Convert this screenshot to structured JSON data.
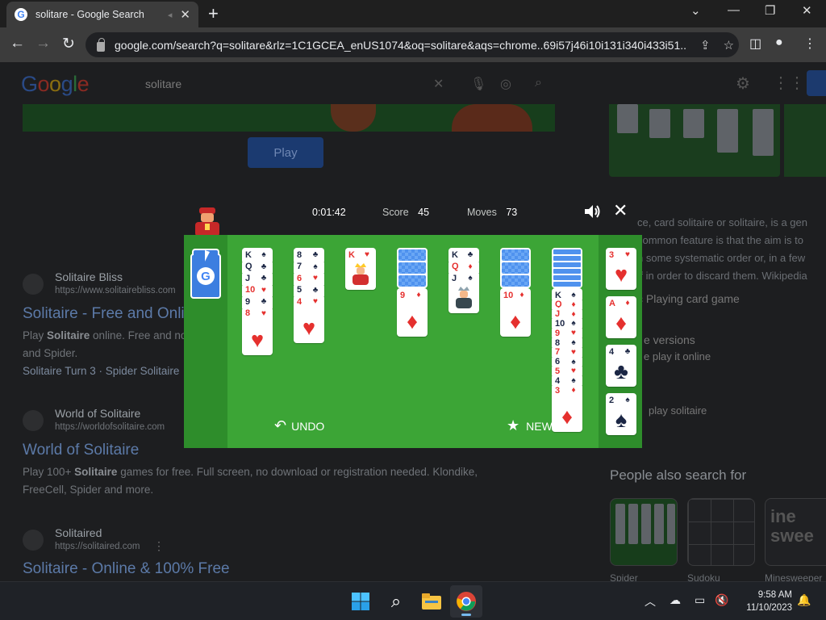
{
  "browser": {
    "tab_title": "solitare - Google Search",
    "favicon_letter": "G",
    "url": "google.com/search?q=solitare&rlz=1C1GCEA_enUS1074&oq=solitare&aqs=chrome..69i57j46i10i131i340i433i51..."
  },
  "google": {
    "logo_letters": [
      "G",
      "o",
      "o",
      "g",
      "l",
      "e"
    ],
    "query": "solitare",
    "play_label": "Play"
  },
  "results": [
    {
      "site": "Solitaire Bliss",
      "url": "https://www.solitairebliss.com",
      "title": "Solitaire - Free and Online",
      "snippet_line1_prefix": "Play ",
      "snippet_line1_bold": "Solitaire",
      "snippet_line1_suffix": " online. Free and no",
      "snippet_line2": "and Spider.",
      "links": "Solitaire Turn 3 · Spider Solitaire"
    },
    {
      "site": "World of Solitaire",
      "url": "https://worldofsolitaire.com",
      "title": "World of Solitaire",
      "snippet_line1_prefix": "Play 100+ ",
      "snippet_line1_bold": "Solitaire",
      "snippet_line1_suffix": " games for free. Full screen, no download or registration needed. Klondike,",
      "snippet_line2": "FreeCell, Spider and more."
    },
    {
      "site": "Solitaired",
      "url": "https://solitaired.com",
      "title": "Solitaire - Online & 100% Free"
    }
  ],
  "knowledge_panel": {
    "lines": [
      "ce, card solitaire or solitaire, is a gen",
      "common feature is that the aim is to",
      "n some systematic order or, in a few",
      "ff in order to discard them. Wikipedia"
    ],
    "type_label": "c Playing card game",
    "versions_title": "e versions",
    "versions_sub": "e play it online",
    "how_to": "play solitaire"
  },
  "people_also_search": {
    "title": "People also search for",
    "items": [
      "Spider",
      "Sudoku",
      "Minesweeper"
    ],
    "minesweeper_thumb_text": [
      "ine",
      "swee"
    ]
  },
  "solitaire": {
    "time": "0:01:42",
    "score_label": "Score",
    "score": "45",
    "moves_label": "Moves",
    "moves": "73",
    "undo_label": "UNDO",
    "new_label": "NEW",
    "stock_logo": "G",
    "columns": [
      {
        "cards": [
          [
            "K",
            "♠"
          ],
          [
            "Q",
            "♣"
          ],
          [
            "J",
            "♣"
          ],
          [
            "10",
            "♥"
          ],
          [
            "9",
            "♣"
          ],
          [
            "8",
            "♥"
          ]
        ]
      },
      {
        "cards": [
          [
            "8",
            "♣"
          ],
          [
            "7",
            "♠"
          ],
          [
            "6",
            "♥"
          ],
          [
            "5",
            "♣"
          ],
          [
            "4",
            "♥"
          ]
        ]
      },
      {
        "cards": [
          [
            "K",
            "♥"
          ]
        ]
      },
      {
        "cards": [
          [
            "9",
            "♦"
          ]
        ]
      },
      {
        "cards": [
          [
            "K",
            "♣"
          ],
          [
            "Q",
            "♦"
          ],
          [
            "J",
            "♠"
          ]
        ]
      },
      {
        "cards": [
          [
            "10",
            "♦"
          ]
        ]
      },
      {
        "cards": [
          [
            "K",
            "♠"
          ],
          [
            "Q",
            "♦"
          ],
          [
            "J",
            "♦"
          ],
          [
            "10",
            "♠"
          ],
          [
            "9",
            "♥"
          ],
          [
            "8",
            "♠"
          ],
          [
            "7",
            "♥"
          ],
          [
            "6",
            "♠"
          ],
          [
            "5",
            "♥"
          ],
          [
            "4",
            "♠"
          ],
          [
            "3",
            "♦"
          ]
        ]
      }
    ],
    "foundations": [
      [
        "3",
        "♥"
      ],
      [
        "A",
        "♦"
      ],
      [
        "4",
        "♣"
      ],
      [
        "2",
        "♠"
      ]
    ]
  },
  "taskbar": {
    "time": "9:58 AM",
    "date": "11/10/2023"
  },
  "colors": {
    "board_green": "#3ca536",
    "side_green": "#2e8d2b",
    "card_red": "#e5302e",
    "card_black": "#1b2644",
    "card_back_blue": "#4f92ee"
  }
}
